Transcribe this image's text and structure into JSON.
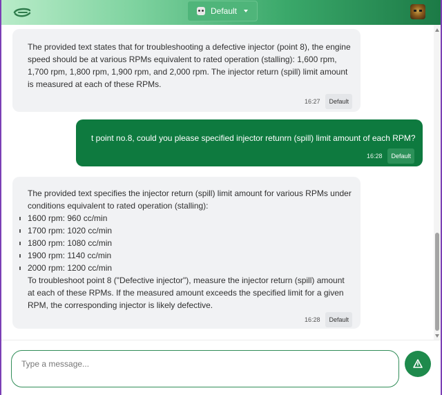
{
  "header": {
    "model_label": "Default"
  },
  "messages": [
    {
      "role": "assistant",
      "text": "The provided text states that for troubleshooting a defective injector (point 8), the engine speed should be at various RPMs equivalent to rated operation (stalling): 1,600 rpm, 1,700 rpm, 1,800 rpm, 1,900 rpm, and 2,000 rpm. The injector return (spill) limit amount is measured at each of these RPMs.",
      "time": "16:27",
      "tag": "Default"
    },
    {
      "role": "user",
      "text": "t point no.8, could you please specified injector retunrn (spill) limit amount of each RPM?",
      "time": "16:28",
      "tag": "Default"
    },
    {
      "role": "assistant",
      "intro": "The provided text specifies the injector return (spill) limit amount for various RPMs under conditions equivalent to rated operation (stalling):",
      "bullets": [
        "1600 rpm: 960 cc/min",
        "1700 rpm: 1020 cc/min",
        "1800 rpm: 1080 cc/min",
        "1900 rpm: 1140 cc/min",
        "2000 rpm: 1200 cc/min"
      ],
      "outro": "To troubleshoot point 8 (\"Defective injector\"), measure the injector return (spill) amount at each of these RPMs. If the measured amount exceeds the specified limit for a given RPM, the corresponding injector is likely defective.",
      "time": "16:28",
      "tag": "Default"
    }
  ],
  "composer": {
    "placeholder": "Type a message..."
  },
  "colors": {
    "accent": "#0e7a3f",
    "header_start": "#b9ecc9",
    "header_end": "#1c7a46"
  }
}
